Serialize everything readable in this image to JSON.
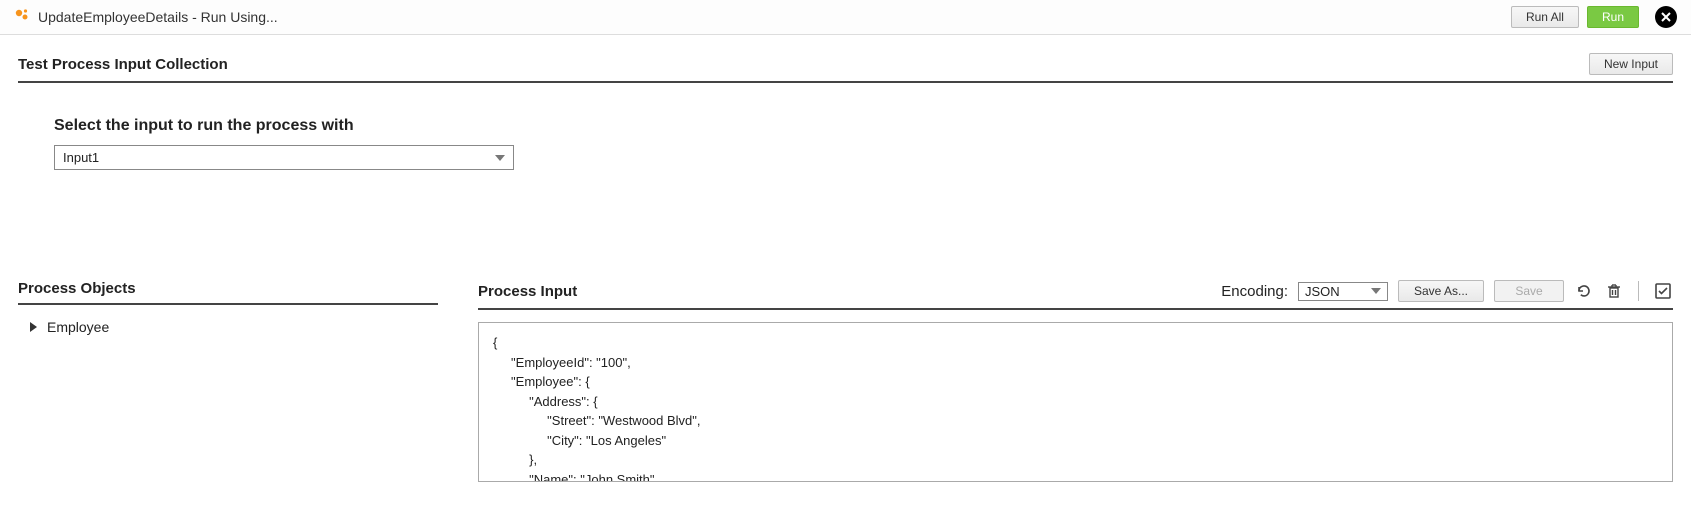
{
  "header": {
    "title": "UpdateEmployeeDetails - Run Using...",
    "run_all_label": "Run All",
    "run_label": "Run"
  },
  "collection": {
    "title": "Test Process Input Collection",
    "new_input_label": "New Input",
    "prompt": "Select the input to run the process with",
    "selected": "Input1"
  },
  "process_objects": {
    "title": "Process Objects",
    "items": [
      "Employee"
    ]
  },
  "process_input": {
    "title": "Process Input",
    "encoding_label": "Encoding:",
    "encoding_value": "JSON",
    "save_as_label": "Save As...",
    "save_label": "Save",
    "body": "{\n     \"EmployeeId\": \"100\",\n     \"Employee\": {\n          \"Address\": {\n               \"Street\": \"Westwood Blvd\",\n               \"City\": \"Los Angeles\"\n          },\n          \"Name\": \"John Smith\"\n     }\n}"
  }
}
